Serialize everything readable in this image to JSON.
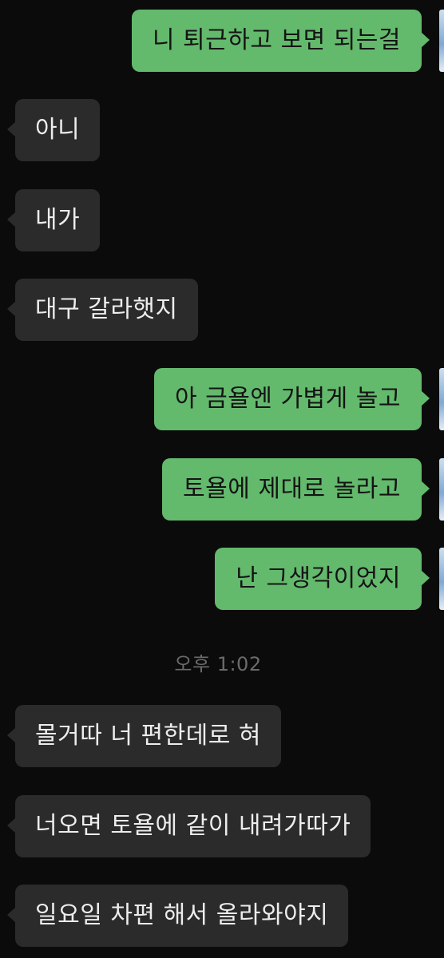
{
  "messages": [
    {
      "direction": "sent",
      "text": "니 퇴근하고 보면 되는걸"
    },
    {
      "direction": "received",
      "text": "아니"
    },
    {
      "direction": "received",
      "text": "내가"
    },
    {
      "direction": "received",
      "text": "대구 갈라햇지"
    },
    {
      "direction": "sent",
      "text": "아 금욜엔 가볍게 놀고"
    },
    {
      "direction": "sent",
      "text": "토욜에 제대로 놀라고"
    },
    {
      "direction": "sent",
      "text": "난 그생각이었지"
    },
    {
      "direction": "received",
      "text": "몰거따 너 편한데로 혀"
    },
    {
      "direction": "received",
      "text": "너오면 토욜에 같이 내려가따가"
    },
    {
      "direction": "received",
      "text": "일요일 차편 해서 올라와야지"
    }
  ],
  "timestamp": "오후 1:02",
  "colors": {
    "background": "#0b0b0b",
    "sent_bubble": "#63b96c",
    "received_bubble": "#2b2b2b",
    "received_text": "#ededed",
    "timestamp_text": "#6b6b6b"
  }
}
